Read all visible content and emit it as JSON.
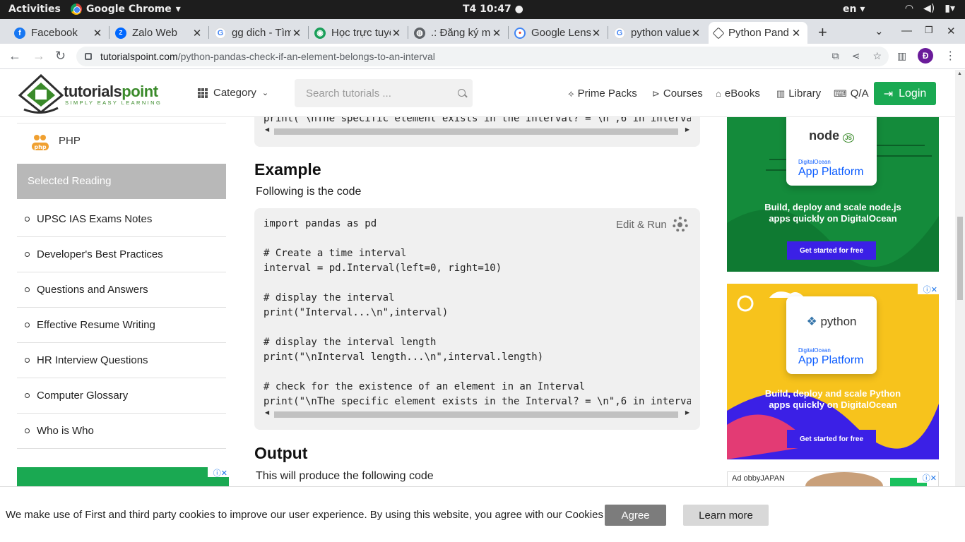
{
  "system_bar": {
    "activities": "Activities",
    "app_name": "Google Chrome",
    "clock": "T4 10:47",
    "language": "en"
  },
  "tabs": [
    {
      "label": "Facebook",
      "icon": "facebook-icon",
      "color": "#1877f2"
    },
    {
      "label": "Zalo Web",
      "icon": "zalo-icon",
      "color": "#0068ff"
    },
    {
      "label": "gg dich - Tìm",
      "icon": "google-icon",
      "color": "#4285f4"
    },
    {
      "label": "Học trực tuyến",
      "icon": "book-icon",
      "color": "#1a9f5a"
    },
    {
      "label": ".: Đăng ký m",
      "icon": "globe-icon",
      "color": "#5f6368"
    },
    {
      "label": "Google Lens",
      "icon": "lens-icon",
      "color": "#ea4335"
    },
    {
      "label": "python value",
      "icon": "google-icon",
      "color": "#4285f4"
    },
    {
      "label": "Python Pand",
      "icon": "tutorialspoint-icon",
      "color": "#444444",
      "active": true
    }
  ],
  "address_bar": {
    "host": "tutorialspoint.com",
    "path": "/python-pandas-check-if-an-element-belongs-to-an-interval",
    "profile_initial": "Đ"
  },
  "site": {
    "logo_word_1": "tutorials",
    "logo_word_2": "point",
    "logo_tagline": "SIMPLY EASY LEARNING",
    "category": "Category",
    "search_placeholder": "Search tutorials ...",
    "nav": [
      {
        "label": "Prime Packs",
        "icon": "prime-packs-icon"
      },
      {
        "label": "Courses",
        "icon": "courses-icon"
      },
      {
        "label": "eBooks",
        "icon": "ebooks-icon"
      },
      {
        "label": "Library",
        "icon": "library-icon"
      },
      {
        "label": "Q/A",
        "icon": "qa-icon"
      }
    ],
    "login": "Login"
  },
  "sidebar": {
    "php_label": "PHP",
    "php_badge": "php",
    "selected_reading": "Selected Reading",
    "items": [
      "UPSC IAS Exams Notes",
      "Developer's Best Practices",
      "Questions and Answers",
      "Effective Resume Writing",
      "HR Interview Questions",
      "Computer Glossary",
      "Who is Who"
    ]
  },
  "content": {
    "top_code_line": "print(\"\\nThe specific element exists in the Interval? = \\n\",6 in interva",
    "example_title": "Example",
    "example_intro": "Following is the code",
    "edit_run": "Edit & Run",
    "code_lines": [
      "import pandas as pd",
      "",
      "# Create a time interval",
      "interval = pd.Interval(left=0, right=10)",
      "",
      "# display the interval",
      "print(\"Interval...\\n\",interval)",
      "",
      "# display the interval length",
      "print(\"\\nInterval length...\\n\",interval.length)",
      "",
      "# check for the existence of an element in an Interval",
      "print(\"\\nThe specific element exists in the Interval? = \\n\",6 in interva"
    ],
    "output_title": "Output",
    "output_intro": "This will produce the following code"
  },
  "ads": {
    "node_brand": "node",
    "node_badge": "JS",
    "python_brand": "python",
    "do_small": "DigitalOcean",
    "do_big": "App Platform",
    "node_text_1": "Build, deploy and scale node.js",
    "node_text_2": "apps quickly on DigitalOcean",
    "python_text_1": "Build, deploy and scale Python",
    "python_text_2": "apps quickly on DigitalOcean",
    "cta": "Get started for free",
    "ad3_label": "Ad obbyJAPAN",
    "close_marker": "ⓘ✕"
  },
  "cookie": {
    "message": "We make use of First and third party cookies to improve our user experience. By using this website, you agree with our Cookies Policy.",
    "agree": "Agree",
    "learn_more": "Learn more"
  }
}
